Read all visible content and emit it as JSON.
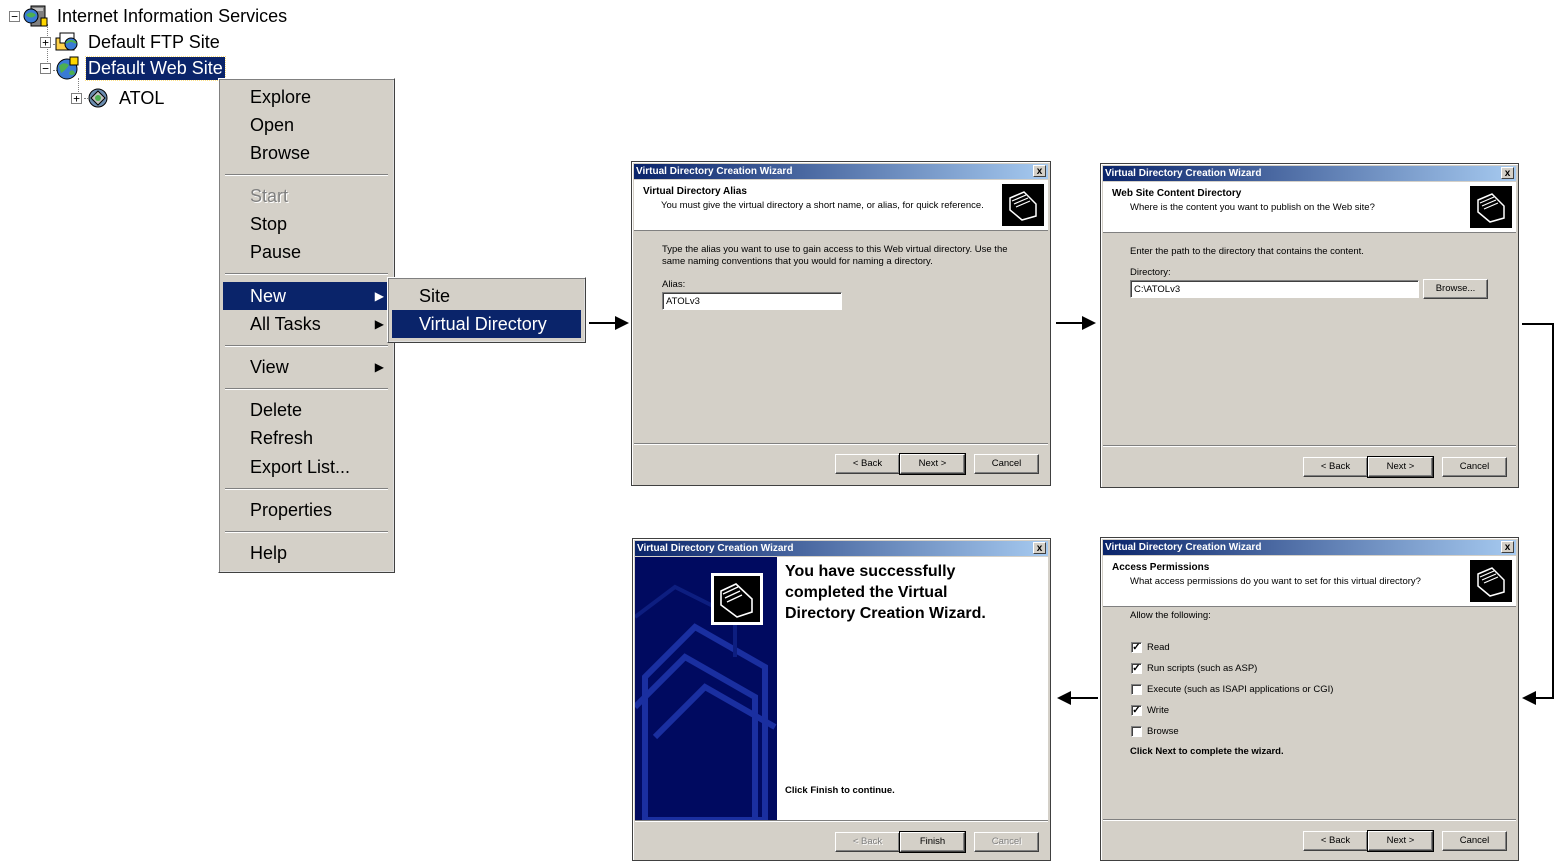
{
  "tree": {
    "root": "Internet Information Services",
    "ftp": "Default FTP Site",
    "web": "Default Web Site",
    "atol": "ATOL"
  },
  "context_menu": {
    "items": [
      "Explore",
      "Open",
      "Browse",
      "Start",
      "Stop",
      "Pause",
      "New",
      "All Tasks",
      "View",
      "Delete",
      "Refresh",
      "Export List...",
      "Properties",
      "Help"
    ],
    "disabled": [
      "Start"
    ],
    "highlighted": "New"
  },
  "submenu": {
    "items": [
      "Site",
      "Virtual Directory"
    ],
    "highlighted": "Virtual Directory"
  },
  "wizard_title": "Virtual Directory Creation Wizard",
  "close_glyph": "x",
  "buttons": {
    "back": "< Back",
    "next": "Next >",
    "cancel": "Cancel",
    "finish": "Finish",
    "browse": "Browse..."
  },
  "step1": {
    "header_title": "Virtual Directory Alias",
    "header_sub": "You must give the virtual directory a short name, or alias, for quick reference.",
    "instr_line1": "Type the alias you want to use to gain access to this Web virtual directory. Use the",
    "instr_line2": "same naming conventions that you would for naming a directory.",
    "alias_label": "Alias:",
    "alias_value": "ATOLv3"
  },
  "step2": {
    "header_title": "Web Site Content Directory",
    "header_sub": "Where is the content you want to publish on the Web site?",
    "instr": "Enter the path to the directory that contains the content.",
    "dir_label": "Directory:",
    "dir_value": "C:\\ATOLv3"
  },
  "step3": {
    "header_title": "Access Permissions",
    "header_sub": "What access permissions do you want to set for this virtual directory?",
    "allow": "Allow the following:",
    "options": [
      {
        "label": "Read",
        "checked": true
      },
      {
        "label": "Run scripts (such as ASP)",
        "checked": true
      },
      {
        "label": "Execute (such as ISAPI applications or CGI)",
        "checked": false
      },
      {
        "label": "Write",
        "checked": true
      },
      {
        "label": "Browse",
        "checked": false
      }
    ],
    "complete": "Click Next to complete the wizard."
  },
  "step4": {
    "heading_line1": "You have successfully",
    "heading_line2": "completed the Virtual",
    "heading_line3": "Directory Creation Wizard.",
    "continue": "Click Finish to continue."
  },
  "colors": {
    "selection": "#0a246a",
    "dialog_bg": "#d4d0c8",
    "titlebar": "#0a246a"
  }
}
